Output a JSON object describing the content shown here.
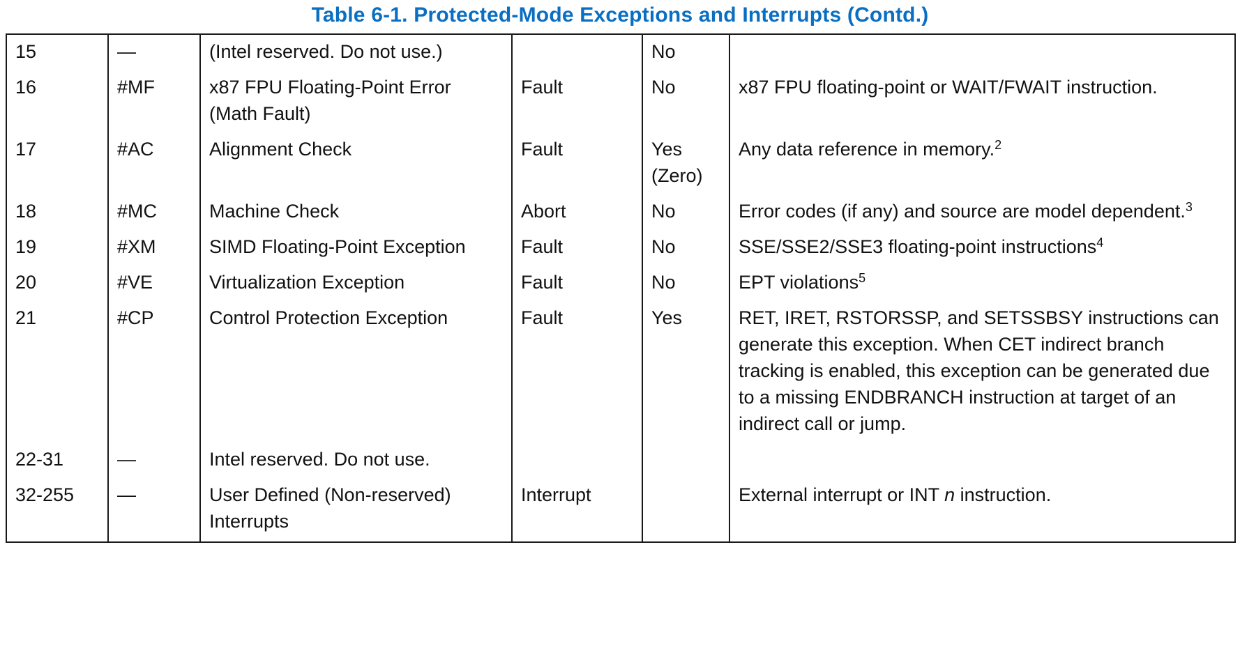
{
  "title": "Table 6-1.  Protected-Mode Exceptions and Interrupts  (Contd.)",
  "rows": [
    {
      "vector": "15",
      "mnemonic": "—",
      "description": "(Intel reserved. Do not use.)",
      "type": "",
      "error_code": "No",
      "source": ""
    },
    {
      "vector": "16",
      "mnemonic": "#MF",
      "description": "x87 FPU Floating-Point Error (Math Fault)",
      "type": "Fault",
      "error_code": "No",
      "source": "x87 FPU floating-point or WAIT/FWAIT instruction."
    },
    {
      "vector": "17",
      "mnemonic": "#AC",
      "description": "Alignment Check",
      "type": "Fault",
      "error_code": "Yes (Zero)",
      "source": "Any data reference in memory.",
      "source_sup": "2"
    },
    {
      "vector": "18",
      "mnemonic": "#MC",
      "description": "Machine Check",
      "type": "Abort",
      "error_code": "No",
      "source": "Error codes (if any) and source are model dependent.",
      "source_sup": "3"
    },
    {
      "vector": "19",
      "mnemonic": "#XM",
      "description": "SIMD Floating-Point Exception",
      "type": "Fault",
      "error_code": "No",
      "source": "SSE/SSE2/SSE3 floating-point instructions",
      "source_sup": "4"
    },
    {
      "vector": "20",
      "mnemonic": "#VE",
      "description": "Virtualization Exception",
      "type": "Fault",
      "error_code": "No",
      "source": "EPT violations",
      "source_sup": "5"
    },
    {
      "vector": "21",
      "mnemonic": "#CP",
      "description": "Control Protection Exception",
      "type": "Fault",
      "error_code": "Yes",
      "source": "RET, IRET, RSTORSSP, and SETSSBSY instructions can generate this exception. When CET indirect branch tracking is enabled, this exception can be generated due to a missing ENDBRANCH instruction at target of an indirect call or jump."
    },
    {
      "vector": "22-31",
      "mnemonic": "—",
      "description": "Intel reserved. Do not use.",
      "type": "",
      "error_code": "",
      "source": ""
    },
    {
      "vector": "32-255",
      "mnemonic": "—",
      "description": "User Defined (Non-reserved) Interrupts",
      "type": "Interrupt",
      "error_code": "",
      "source_pre": "External interrupt or INT ",
      "source_italic": "n",
      "source_post": " instruction."
    }
  ]
}
